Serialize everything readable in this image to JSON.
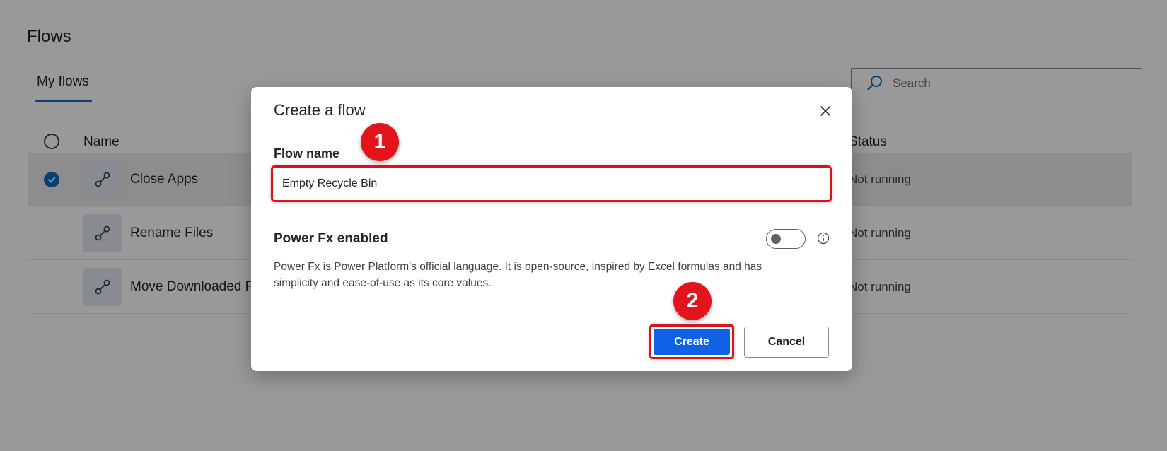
{
  "page": {
    "title": "Flows",
    "tabs": [
      {
        "label": "My flows",
        "active": true
      }
    ],
    "search": {
      "placeholder": "Search",
      "value": ""
    },
    "table": {
      "columns": {
        "name": "Name",
        "status": "Status"
      },
      "rows": [
        {
          "name": "Close Apps",
          "status": "Not running",
          "selected": true
        },
        {
          "name": "Rename Files",
          "status": "Not running",
          "selected": false
        },
        {
          "name": "Move Downloaded Files",
          "status": "Not running",
          "selected": false
        }
      ]
    }
  },
  "dialog": {
    "title": "Create a flow",
    "flow_name_label": "Flow name",
    "flow_name_value": "Empty Recycle Bin",
    "power_fx_label": "Power Fx enabled",
    "power_fx_enabled": false,
    "power_fx_description": "Power Fx is Power Platform's official language. It is open-source, inspired by Excel formulas and has simplicity and ease-of-use as its core values.",
    "create_label": "Create",
    "cancel_label": "Cancel"
  },
  "annotations": {
    "step1": "1",
    "step2": "2"
  },
  "icons": {
    "search": "search-icon",
    "close": "close-icon",
    "info": "info-icon",
    "flow": "flow-icon",
    "check": "checkmark-icon"
  },
  "colors": {
    "accent": "#0f6cbd",
    "create_button": "#0f62e6",
    "highlight": "#d6141e",
    "badge": "#e3141c"
  }
}
